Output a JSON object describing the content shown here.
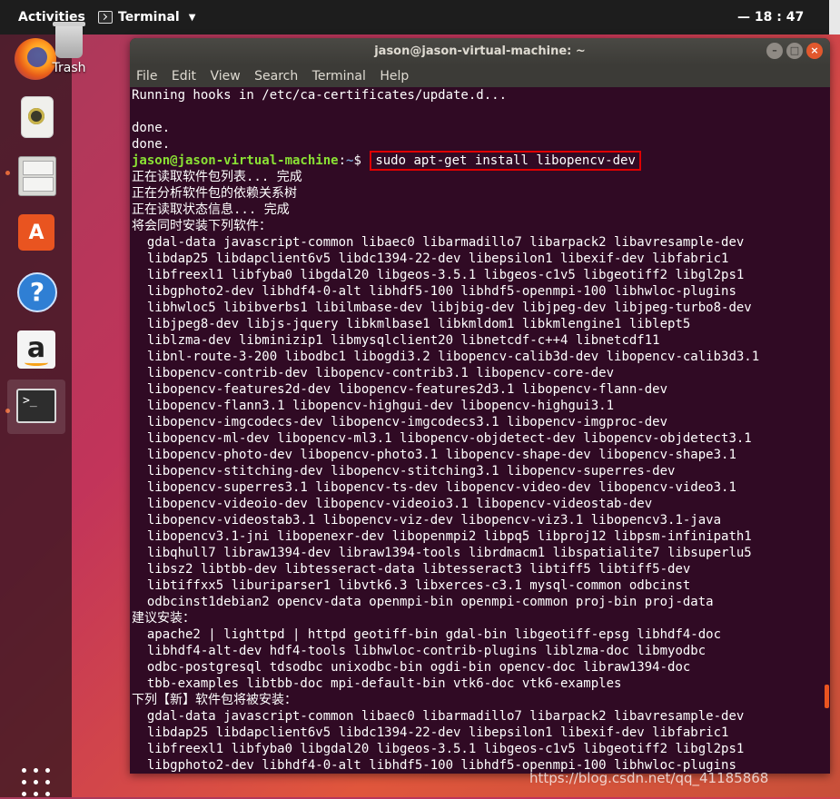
{
  "topbar": {
    "activities": "Activities",
    "app_name": "Terminal",
    "app_menu_arrow": "▼",
    "clock": "— 18 : 47"
  },
  "desktop": {
    "trash_label": "Trash"
  },
  "dock": {
    "items": [
      {
        "name": "firefox",
        "icon": "firefox-icon"
      },
      {
        "name": "rhythmbox",
        "icon": "speaker-icon"
      },
      {
        "name": "files",
        "icon": "file-cabinet-icon"
      },
      {
        "name": "software",
        "icon": "shopping-bag-icon",
        "glyph": "A"
      },
      {
        "name": "help",
        "icon": "help-icon",
        "glyph": "?"
      },
      {
        "name": "amazon",
        "icon": "amazon-icon",
        "glyph": "a"
      },
      {
        "name": "terminal",
        "icon": "terminal-icon",
        "glyph": ">_"
      }
    ]
  },
  "window": {
    "title": "jason@jason-virtual-machine: ~",
    "menu": [
      "File",
      "Edit",
      "View",
      "Search",
      "Terminal",
      "Help"
    ],
    "buttons": {
      "minimize": "–",
      "maximize": "□",
      "close": "×"
    }
  },
  "terminal": {
    "prompt_user": "jason@jason-virtual-machine",
    "prompt_sep": ":",
    "prompt_path": "~",
    "prompt_symbol": "$ ",
    "command": "sudo apt-get install libopencv-dev",
    "before": [
      "Running hooks in /etc/ca-certificates/update.d...",
      "",
      "done.",
      "done."
    ],
    "after": [
      "正在读取软件包列表... 完成",
      "正在分析软件包的依赖关系树",
      "正在读取状态信息... 完成",
      "将会同时安装下列软件：",
      "  gdal-data javascript-common libaec0 libarmadillo7 libarpack2 libavresample-dev",
      "  libdap25 libdapclient6v5 libdc1394-22-dev libepsilon1 libexif-dev libfabric1",
      "  libfreexl1 libfyba0 libgdal20 libgeos-3.5.1 libgeos-c1v5 libgeotiff2 libgl2ps1",
      "  libgphoto2-dev libhdf4-0-alt libhdf5-100 libhdf5-openmpi-100 libhwloc-plugins",
      "  libhwloc5 libibverbs1 libilmbase-dev libjbig-dev libjpeg-dev libjpeg-turbo8-dev",
      "  libjpeg8-dev libjs-jquery libkmlbase1 libkmldom1 libkmlengine1 liblept5",
      "  liblzma-dev libminizip1 libmysqlclient20 libnetcdf-c++4 libnetcdf11",
      "  libnl-route-3-200 libodbc1 libogdi3.2 libopencv-calib3d-dev libopencv-calib3d3.1",
      "  libopencv-contrib-dev libopencv-contrib3.1 libopencv-core-dev",
      "  libopencv-features2d-dev libopencv-features2d3.1 libopencv-flann-dev",
      "  libopencv-flann3.1 libopencv-highgui-dev libopencv-highgui3.1",
      "  libopencv-imgcodecs-dev libopencv-imgcodecs3.1 libopencv-imgproc-dev",
      "  libopencv-ml-dev libopencv-ml3.1 libopencv-objdetect-dev libopencv-objdetect3.1",
      "  libopencv-photo-dev libopencv-photo3.1 libopencv-shape-dev libopencv-shape3.1",
      "  libopencv-stitching-dev libopencv-stitching3.1 libopencv-superres-dev",
      "  libopencv-superres3.1 libopencv-ts-dev libopencv-video-dev libopencv-video3.1",
      "  libopencv-videoio-dev libopencv-videoio3.1 libopencv-videostab-dev",
      "  libopencv-videostab3.1 libopencv-viz-dev libopencv-viz3.1 libopencv3.1-java",
      "  libopencv3.1-jni libopenexr-dev libopenmpi2 libpq5 libproj12 libpsm-infinipath1",
      "  libqhull7 libraw1394-dev libraw1394-tools librdmacm1 libspatialite7 libsuperlu5",
      "  libsz2 libtbb-dev libtesseract-data libtesseract3 libtiff5 libtiff5-dev",
      "  libtiffxx5 liburiparser1 libvtk6.3 libxerces-c3.1 mysql-common odbcinst",
      "  odbcinst1debian2 opencv-data openmpi-bin openmpi-common proj-bin proj-data",
      "建议安装：",
      "  apache2 | lighttpd | httpd geotiff-bin gdal-bin libgeotiff-epsg libhdf4-doc",
      "  libhdf4-alt-dev hdf4-tools libhwloc-contrib-plugins liblzma-doc libmyodbc",
      "  odbc-postgresql tdsodbc unixodbc-bin ogdi-bin opencv-doc libraw1394-doc",
      "  tbb-examples libtbb-doc mpi-default-bin vtk6-doc vtk6-examples",
      "下列【新】软件包将被安装：",
      "  gdal-data javascript-common libaec0 libarmadillo7 libarpack2 libavresample-dev",
      "  libdap25 libdapclient6v5 libdc1394-22-dev libepsilon1 libexif-dev libfabric1",
      "  libfreexl1 libfyba0 libgdal20 libgeos-3.5.1 libgeos-c1v5 libgeotiff2 libgl2ps1",
      "  libgphoto2-dev libhdf4-0-alt libhdf5-100 libhdf5-openmpi-100 libhwloc-plugins"
    ]
  },
  "watermark": "https://blog.csdn.net/qq_41185868",
  "colors": {
    "terminal_bg": "#300a24",
    "prompt_user": "#8ae234",
    "prompt_path": "#729fcf",
    "highlight_box": "#e00000",
    "accent": "#e95420"
  }
}
